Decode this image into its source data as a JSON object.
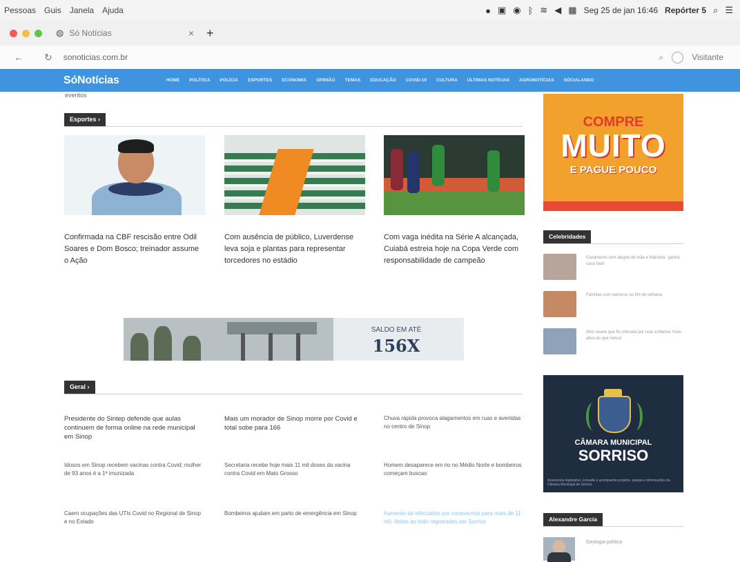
{
  "menubar": {
    "items": [
      "Pessoas",
      "Guis",
      "Janela",
      "Ajuda"
    ],
    "clock": "Seg 25 de jan 16:46",
    "user": "Repórter 5"
  },
  "browser": {
    "tab_title": "Só Notícias",
    "url": "sonoticias.com.br",
    "profile_label": "Visitante"
  },
  "site": {
    "logo": "SóNotícias",
    "nav": [
      "HOME",
      "POLÍTICA",
      "POLÍCIA",
      "ESPORTES",
      "ECONOMIA",
      "OPINIÃO",
      "TEMAS",
      "EDUCAÇÃO",
      "COVID-19",
      "CULTURA",
      "ÚLTIMAS NOTÍCIAS",
      "AGRONOTÍCIAS",
      "SÓCIALANDO"
    ],
    "clipped_text": "eventos"
  },
  "esportes": {
    "label": "Esportes ›",
    "cards": [
      {
        "title": "Confirmada na CBF rescisão entre Odil Soares e Dom Bosco; treinador assume o Ação"
      },
      {
        "title": "Com ausência de público, Luverdense leva soja e plantas para representar torcedores no estádio"
      },
      {
        "title": "Com vaga inédita na Série A alcançada, Cuiabá estreia hoje na Copa Verde com responsabilidade de campeão"
      }
    ]
  },
  "banner": {
    "line1": "SALDO EM ATÉ",
    "line2": "156X"
  },
  "geral": {
    "label": "Geral ›",
    "items": [
      {
        "title": "Presidente do Sintep defende que aulas continuem de forma online na rede municipal em Sinop"
      },
      {
        "title": "Mais um morador de Sinop morre por Covid e total sobe para 166"
      },
      {
        "title": "Chuva rápida provoca alagamentos em ruas e avenidas no centro de Sinop"
      },
      {
        "title": "Idosos em Sinop recebem vacinas contra Covid; mulher de 93 anos é a 1ª imunizada"
      },
      {
        "title": "Secretaria recebe hoje mais 11 mil doses da vacina contra Covid em Mato Grosso"
      },
      {
        "title": "Homem desaparece em rio no Médio Norte e bombeiros começam buscas"
      },
      {
        "title": "Caem ocupações das UTIs Covid no Regional de Sinop e no Estado"
      },
      {
        "title": "Bombeiros ajudam em parto de emergência em Sinop"
      },
      {
        "title": "Aumento de infectados por coronavírus para mais de 11 mil; óbitos ao todo registrados em Sorriso"
      }
    ]
  },
  "sidebar": {
    "ad1": {
      "line1": "COMPRE",
      "line2": "MUITO",
      "line3": "E PAGUE POUCO"
    },
    "celebridades_label": "Celebridades",
    "celebs": [
      {
        "title": "Casamento sem alegria de mãe e Marcella: 'ganha casa fatal'"
      },
      {
        "title": "Famílias com namoros no fim de semana"
      },
      {
        "title": "Atriz revela que foi criticada por usar a Marina 'mais ativa do que nunca'"
      }
    ],
    "ad2": {
      "line1": "CÂMARA MUNICIPAL",
      "line2": "SORRISO",
      "fine": "Assessoria legislativa: consulte e acompanhe projetos, pautas e informações da Câmara Municipal de Sorriso"
    },
    "alexandre_label": "Alexandre Garcia",
    "author_title": "Geologia política"
  },
  "colors": {
    "nav_blue": "#3f93df",
    "section_label_bg": "#333333",
    "ad_orange": "#f2a12c",
    "ad_navy": "#1e2d40"
  }
}
